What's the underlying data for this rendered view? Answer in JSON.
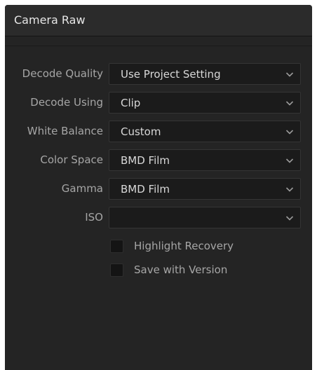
{
  "panel": {
    "title": "Camera Raw"
  },
  "fields": [
    {
      "label": "Decode Quality",
      "value": "Use Project Setting",
      "icon": "chevron-down-icon"
    },
    {
      "label": "Decode Using",
      "value": "Clip",
      "icon": "chevron-down-icon"
    },
    {
      "label": "White Balance",
      "value": "Custom",
      "icon": "chevron-down-icon"
    },
    {
      "label": "Color Space",
      "value": "BMD Film",
      "icon": "chevron-down-icon"
    },
    {
      "label": "Gamma",
      "value": "BMD Film",
      "icon": "chevron-down-icon"
    },
    {
      "label": "ISO",
      "value": "",
      "icon": "chevron-down-icon"
    }
  ],
  "checkboxes": [
    {
      "label": "Highlight Recovery",
      "checked": false
    },
    {
      "label": "Save with Version",
      "checked": false
    }
  ],
  "colors": {
    "panel_background": "#242424",
    "header_background": "#2b2b2b",
    "field_background": "#1b1b1b",
    "label_text": "#a6a6a6",
    "value_text": "#d8d8d8"
  }
}
